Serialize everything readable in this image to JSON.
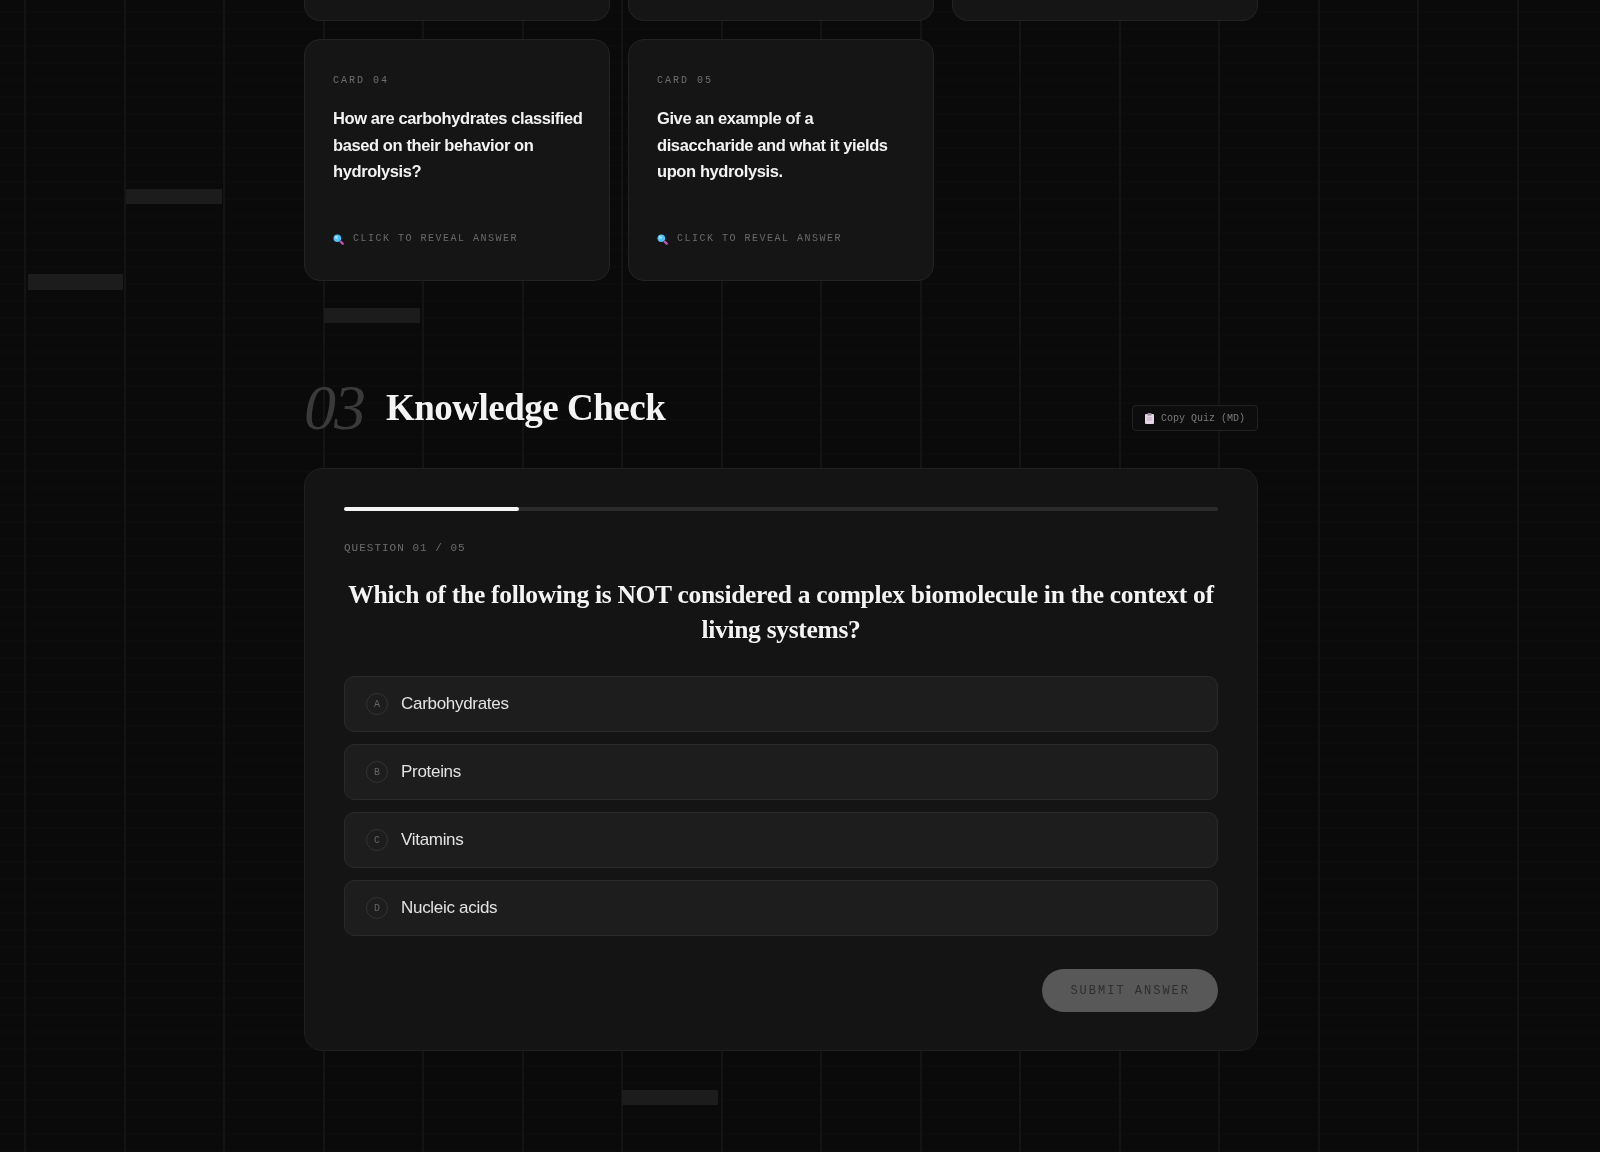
{
  "flashcards": [
    {
      "kind": "clipped"
    },
    {
      "kind": "clipped"
    },
    {
      "kind": "clipped"
    },
    {
      "kind": "full",
      "label": "CARD 04",
      "question": "How are carbohydrates classified based on their behavior on hydrolysis?",
      "hint": "CLICK TO REVEAL ANSWER"
    },
    {
      "kind": "full",
      "label": "CARD 05",
      "question": "Give an example of a disaccharide and what it yields upon hydrolysis.",
      "hint": "CLICK TO REVEAL ANSWER"
    }
  ],
  "section": {
    "number": "03",
    "title": "Knowledge Check",
    "copy_button": "Copy Quiz (MD)"
  },
  "quiz": {
    "progress": {
      "level": 0.2
    },
    "counter": "QUESTION 01 / 05",
    "question": "Which of the following is NOT considered a complex biomolecule in the context of living systems?",
    "options": [
      {
        "letter": "A",
        "text": "Carbohydrates",
        "selected": false
      },
      {
        "letter": "B",
        "text": "Proteins",
        "selected": false
      },
      {
        "letter": "C",
        "text": "Vitamins",
        "selected": false
      },
      {
        "letter": "D",
        "text": "Nucleic acids",
        "selected": false
      }
    ],
    "submit": {
      "label": "SUBMIT ANSWER",
      "disabled": true
    }
  }
}
